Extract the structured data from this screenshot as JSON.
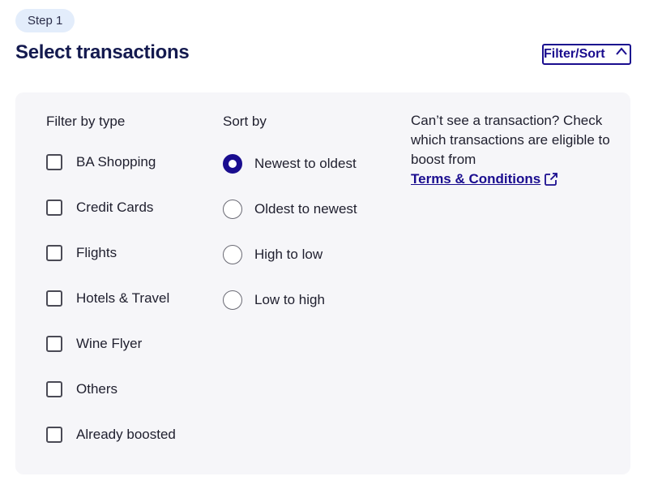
{
  "step_label": "Step 1",
  "title": "Select transactions",
  "filter_button": {
    "label": "Filter/Sort",
    "icon": "chevron-up-icon"
  },
  "filter_by_type": {
    "heading": "Filter by type",
    "options": [
      "BA Shopping",
      "Credit Cards",
      "Flights",
      "Hotels & Travel",
      "Wine Flyer",
      "Others",
      "Already boosted"
    ]
  },
  "sort_by": {
    "heading": "Sort by",
    "options": [
      "Newest to oldest",
      "Oldest to newest",
      "High to low",
      "Low to high"
    ],
    "selected": "Newest to oldest"
  },
  "info": {
    "text": "Can’t see a transaction? Check which transactions are eligible to boost from",
    "link_label": "Terms & Conditions",
    "link_icon": "external-link-icon"
  },
  "colors": {
    "accent": "#1a0d8f",
    "title": "#141a4f",
    "badge_bg": "#e3edfb",
    "panel_bg": "#f6f6f9"
  }
}
